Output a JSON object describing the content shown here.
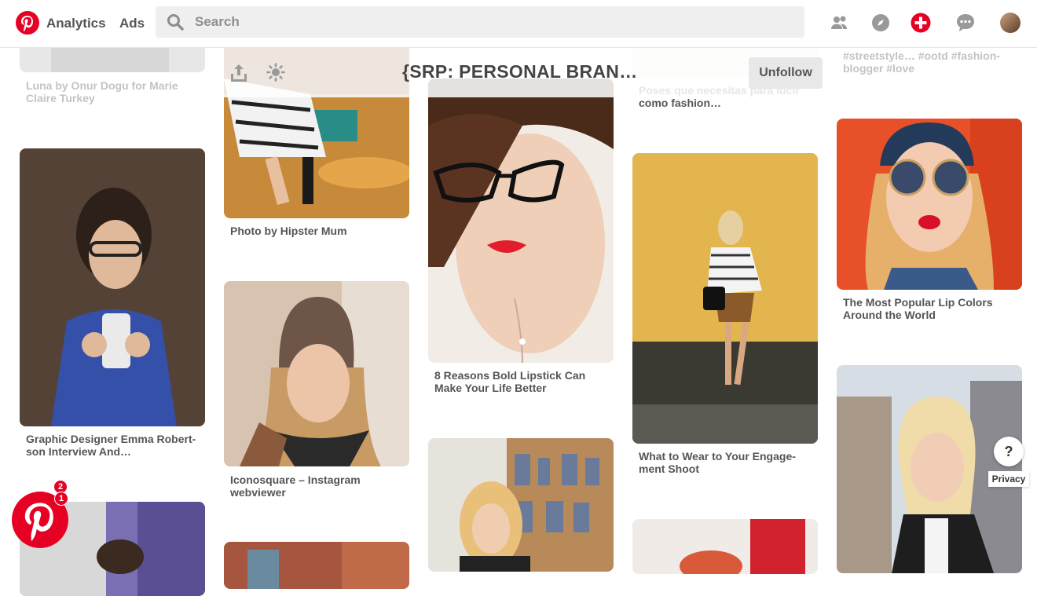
{
  "nav": {
    "analytics": "Analytics",
    "ads": "Ads",
    "search_placeholder": "Search"
  },
  "board": {
    "title": "{SRP: PERSONAL BRAN…",
    "unfollow": "Unfollow"
  },
  "pins": [
    {
      "caption": "Luna by Onur Dogu for Marie Claire Turkey"
    },
    {
      "caption": "Graphic Designer Emma Robert-son Interview And…"
    },
    {
      "caption": "Photo by Hipster Mum"
    },
    {
      "caption": "Iconosquare – Instagram webviewer"
    },
    {
      "caption": "8 Reasons Bold Lipstick Can Make Your Life Better"
    },
    {
      "caption": "Poses que necesitas para lucir como fashion…"
    },
    {
      "caption": "What to Wear to Your Engage-ment Shoot"
    },
    {
      "caption": "#streetstyle… #ootd #fashion-blogger #love"
    },
    {
      "caption": "The Most Popular Lip Colors Around the World"
    }
  ],
  "notifications": {
    "badge_top": "2",
    "badge_bottom": "1"
  },
  "help": {
    "label": "?",
    "privacy": "Privacy"
  },
  "colors": {
    "brand": "#e60023",
    "search_bg": "#efefef"
  }
}
